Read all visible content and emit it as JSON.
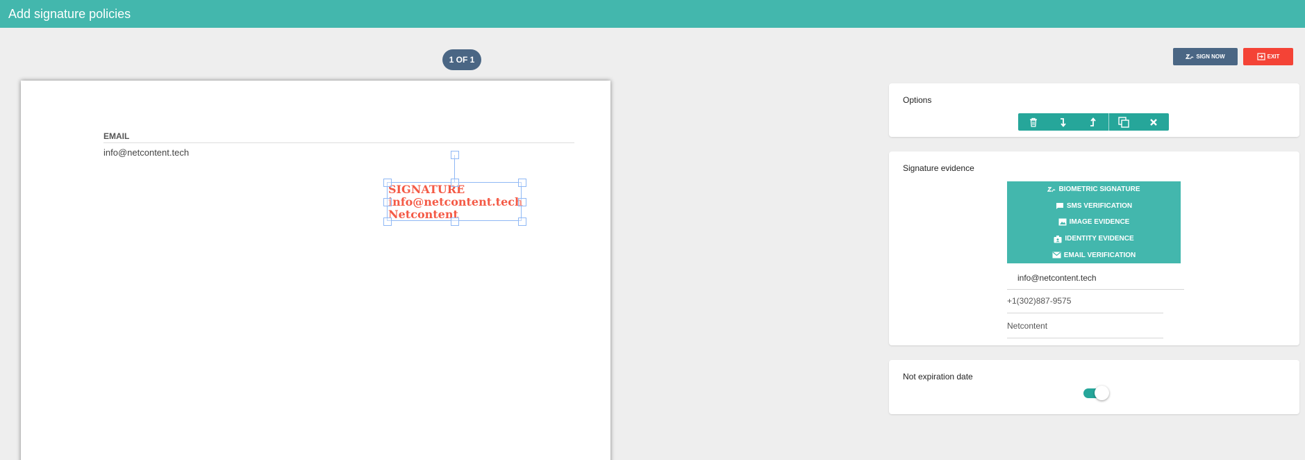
{
  "header": {
    "title": "Add signature policies"
  },
  "pager": {
    "label": "1 OF 1"
  },
  "document": {
    "email_label": "EMAIL",
    "email_value": "info@netcontent.tech",
    "signature_block": {
      "line1": "SIGNATURE",
      "line2": "info@netcontent.tech",
      "line3": "Netcontent"
    }
  },
  "actions": {
    "sign_now": "SIGN NOW",
    "exit": "EXIT"
  },
  "options_card": {
    "title": "Options",
    "buttons": [
      "delete-icon",
      "move-down-icon",
      "move-up-icon",
      "duplicate-icon",
      "close-icon"
    ]
  },
  "evidence_card": {
    "title": "Signature evidence",
    "items": [
      {
        "label": "BIOMETRIC SIGNATURE",
        "icon": "signature-icon"
      },
      {
        "label": "SMS VERIFICATION",
        "icon": "sms-icon"
      },
      {
        "label": "IMAGE EVIDENCE",
        "icon": "image-icon"
      },
      {
        "label": "IDENTITY EVIDENCE",
        "icon": "identity-icon"
      },
      {
        "label": "EMAIL VERIFICATION",
        "icon": "mail-icon"
      }
    ],
    "email": "info@netcontent.tech",
    "phone": "+1(302)887-9575",
    "name": "Netcontent"
  },
  "expiry_card": {
    "title": "Not expiration date",
    "toggle_on": true
  },
  "colors": {
    "primary": "#43b7ad",
    "accent": "#26a69a",
    "navy": "#4a6684",
    "danger": "#f44336",
    "signature": "#f45a46"
  }
}
